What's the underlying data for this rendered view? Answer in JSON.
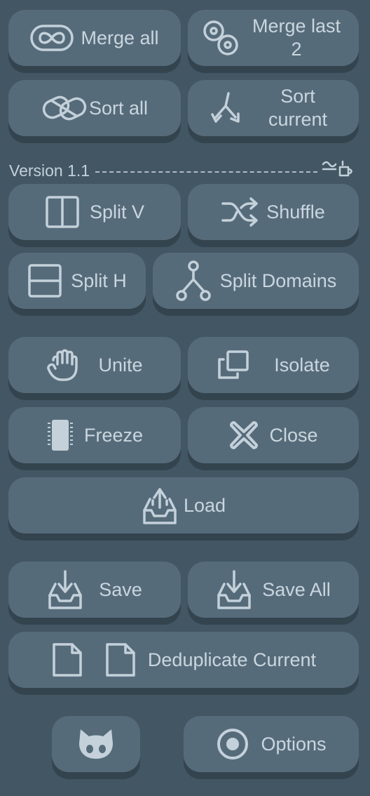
{
  "buttons": {
    "merge_all": "Merge all",
    "merge_last_2": "Merge last 2",
    "sort_all": "Sort all",
    "sort_current": "Sort current",
    "split_v": "Split V",
    "shuffle": "Shuffle",
    "split_h": "Split H",
    "split_domains": "Split Domains",
    "unite": "Unite",
    "isolate": "Isolate",
    "freeze": "Freeze",
    "close": "Close",
    "load": "Load",
    "save": "Save",
    "save_all": "Save All",
    "deduplicate_current": "Deduplicate Current",
    "options": "Options"
  },
  "version": {
    "text": "Version 1.1"
  },
  "icons": {
    "merge_all": "infinity-icon",
    "merge_last_2": "link-icon",
    "sort_all": "chain-link-icon",
    "sort_current": "split-arrows-icon",
    "version": "coffee-cup-icon",
    "split_v": "split-vertical-icon",
    "shuffle": "shuffle-icon",
    "split_h": "split-horizontal-icon",
    "split_domains": "tree-icon",
    "unite": "hand-icon",
    "isolate": "window-restore-icon",
    "freeze": "chip-icon",
    "close": "close-x-icon",
    "load": "tray-upload-icon",
    "save": "tray-download-icon",
    "save_all": "tray-download-icon",
    "deduplicate_current": "duplicate-files-icon",
    "github": "github-icon",
    "options": "record-circle-icon"
  },
  "colors": {
    "background": "#435663",
    "button": "#566b7a",
    "button_shadow": "#34444f",
    "text": "#c4d1da"
  }
}
